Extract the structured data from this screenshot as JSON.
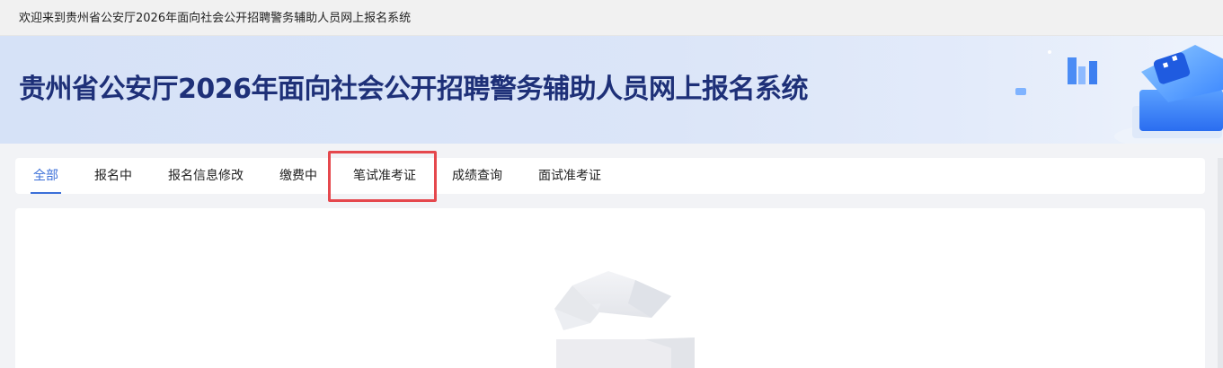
{
  "topbar": {
    "welcome_text": "欢迎来到贵州省公安厅2026年面向社会公开招聘警务辅助人员网上报名系统"
  },
  "banner": {
    "title": "贵州省公安厅2026年面向社会公开招聘警务辅助人员网上报名系统"
  },
  "tabs": [
    {
      "label": "全部",
      "active": true
    },
    {
      "label": "报名中",
      "active": false
    },
    {
      "label": "报名信息修改",
      "active": false
    },
    {
      "label": "缴费中",
      "active": false
    },
    {
      "label": "笔试准考证",
      "active": false,
      "highlighted": true
    },
    {
      "label": "成绩查询",
      "active": false
    },
    {
      "label": "面试准考证",
      "active": false
    }
  ],
  "colors": {
    "accent": "#3b6fd8",
    "title": "#1e3078",
    "highlight": "#e5484d"
  },
  "content": {
    "state": "empty",
    "illustration": "empty-box-icon"
  }
}
